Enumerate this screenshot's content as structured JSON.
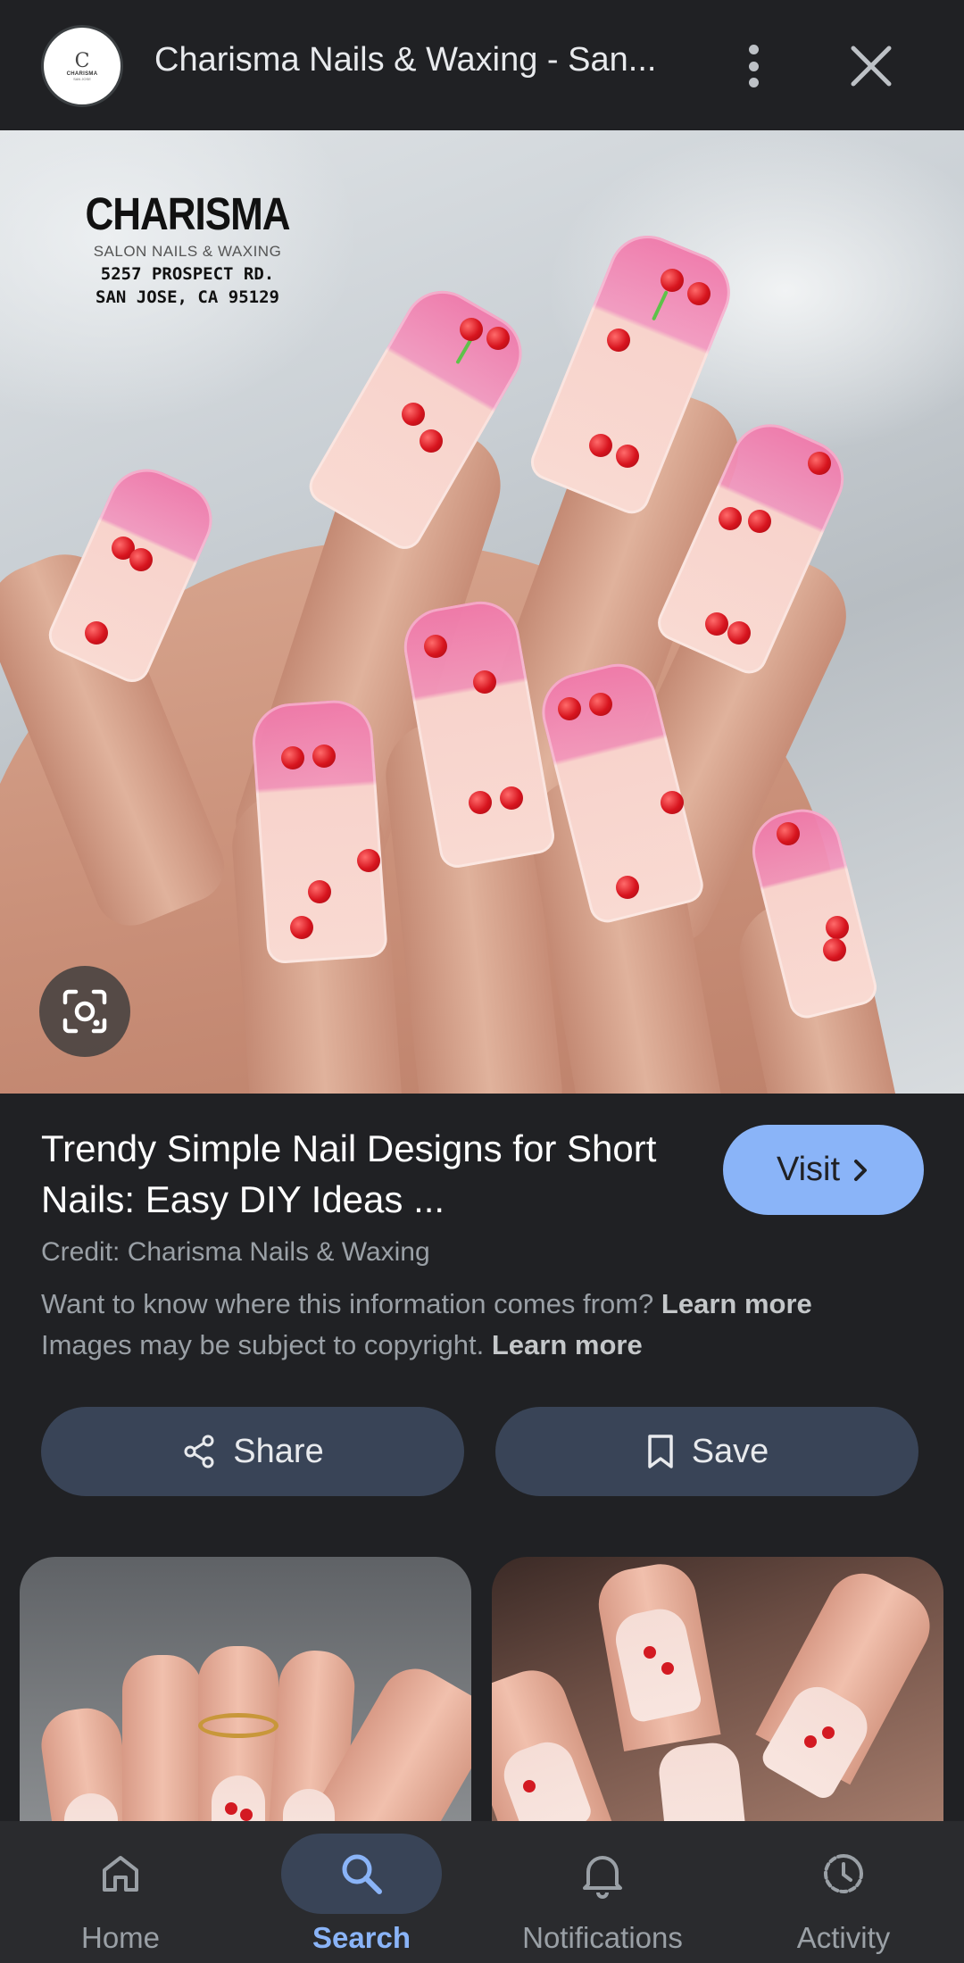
{
  "header": {
    "source_logo_title": "CHARISMA",
    "source_logo_sub": "SAN JOSE",
    "title": "Charisma Nails & Waxing - San..."
  },
  "image": {
    "watermark_title": "CHARISMA",
    "watermark_sub": "SALON NAILS & WAXING",
    "watermark_addr1": "5257 PROSPECT RD.",
    "watermark_addr2": "SAN JOSE, CA 95129"
  },
  "result": {
    "title": "Trendy Simple Nail Designs for Short Nails: Easy DIY Ideas ...",
    "visit_label": "Visit",
    "credit": "Credit: Charisma Nails & Waxing",
    "info_text": "Want to know where this information comes from?",
    "copyright_text": "Images may be subject to copyright.",
    "learn_more": "Learn more"
  },
  "actions": {
    "share_label": "Share",
    "save_label": "Save"
  },
  "nav": {
    "items": [
      {
        "label": "Home",
        "icon": "home-icon"
      },
      {
        "label": "Search",
        "icon": "search-icon"
      },
      {
        "label": "Notifications",
        "icon": "bell-icon"
      },
      {
        "label": "Activity",
        "icon": "activity-icon"
      }
    ]
  },
  "colors": {
    "background": "#202124",
    "accent": "#8ab4f8",
    "button_bg": "#394457",
    "nav_bg": "#2a2b2e"
  }
}
